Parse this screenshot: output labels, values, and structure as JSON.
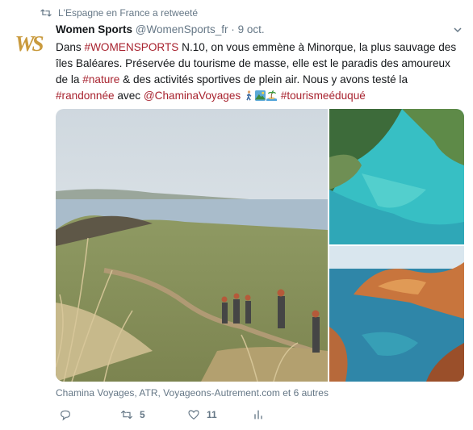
{
  "retweet": {
    "label": "L'Espagne en France a retweeté",
    "icon": "retweet-icon"
  },
  "author": {
    "avatar_text": "WS",
    "name": "Women Sports",
    "handle": "@WomenSports_fr",
    "separator": "·",
    "date": "9 oct."
  },
  "tweet": {
    "t1": "Dans ",
    "h1": "#WOMENSPORTS",
    "t2": " N.10, on vous emmène à Minorque, la plus sauvage des îles Baléares. Préservée du tourisme de masse, elle est le paradis des amoureux de la ",
    "h2": "#nature",
    "t3": " & des activités sportives de plein air. Nous y avons testé la ",
    "h3": "#randonnée",
    "t4": " avec ",
    "m1": "@ChaminaVoyages",
    "h4": "#tourismeéduqué",
    "emojis": [
      "person-walking-emoji",
      "mountain-photo-emoji",
      "island-emoji"
    ]
  },
  "media": {
    "images": [
      "hiking-trail-photo",
      "turquoise-cove-photo",
      "rocky-coast-photo"
    ]
  },
  "attribution": "Chamina Voyages, ATR, Voyageons-Autrement.com et 6 autres",
  "actions": {
    "reply_count": "",
    "retweet_count": "5",
    "like_count": "11"
  },
  "colors": {
    "accent": "#a8232f",
    "secondary_text": "#657786",
    "brand_gold": "#c99a3d"
  }
}
